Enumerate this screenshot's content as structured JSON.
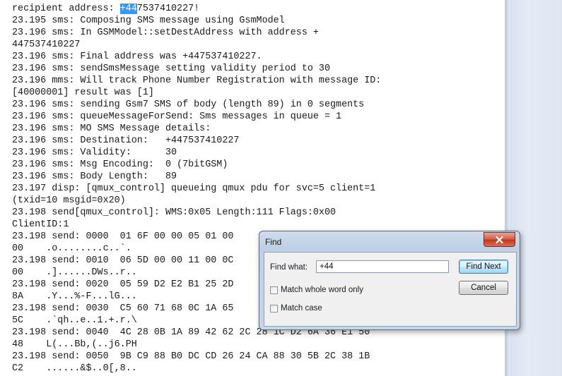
{
  "log": {
    "first_line": {
      "prefix": "recipient address: ",
      "highlight": "+44",
      "suffix": "7537410227!"
    },
    "lines": [
      "23.195 sms: Composing SMS message using GsmModel",
      "23.196 sms: In GSMModel::setDestAddress with address +",
      "447537410227",
      "23.196 sms: Final address was +447537410227.",
      "23.196 sms: sendSmsMessage setting validity period to 30",
      "23.196 mms: Will track Phone Number Registration with message ID:",
      "[40000001] result was [1]",
      "23.196 sms: sending Gsm7 SMS of body (length 89) in 0 segments",
      "23.196 sms: queueMessageForSend: Sms messages in queue = 1",
      "23.196 sms: MO SMS Message details:",
      "23.196 sms: Destination:   +447537410227",
      "23.196 sms: Validity:      30",
      "23.196 sms: Msg Encoding:  0 (7bitGSM)",
      "23.196 sms: Body Length:   89",
      "23.197 disp: [qmux_control] queueing qmux pdu for svc=5 client=1",
      "(txid=10 msgid=0x20)",
      "23.198 send[qmux_control]: WMS:0x05 Length:111 Flags:0x00",
      "ClientID:1",
      "23.198 send: 0000  01 6F 00 00 05 01 00",
      "00    .o........c..`.",
      "23.198 send: 0010  06 5D 00 00 11 00 0C",
      "00    .]......DWs..r..",
      "23.198 send: 0020  05 59 D2 E2 B1 25 2D",
      "8A    .Y...%-F...lG...",
      "23.198 send: 0030  C5 60 71 68 0C 1A 65",
      "5C    .`qh..e..1.+.r.\\",
      "23.198 send: 0040  4C 28 0B 1A 89 42 62 2C 28 1C D2 6A 36 E1 50",
      "48    L(...Bb,(..j6.PH",
      "23.198 send: 0050  9B C9 88 B0 DC CD 26 24 CA 88 30 5B 2C 38 1B",
      "C2    ......&$..0[,8.."
    ]
  },
  "find_dialog": {
    "title": "Find",
    "find_what_label": "Find what:",
    "find_what_value": "+44",
    "find_next_label": "Find Next",
    "cancel_label": "Cancel",
    "match_whole_word_label": "Match whole word only",
    "match_case_label": "Match case",
    "close_icon": "close-icon"
  },
  "colors": {
    "selection": "#3399ff",
    "close_button": "#c0391f"
  }
}
